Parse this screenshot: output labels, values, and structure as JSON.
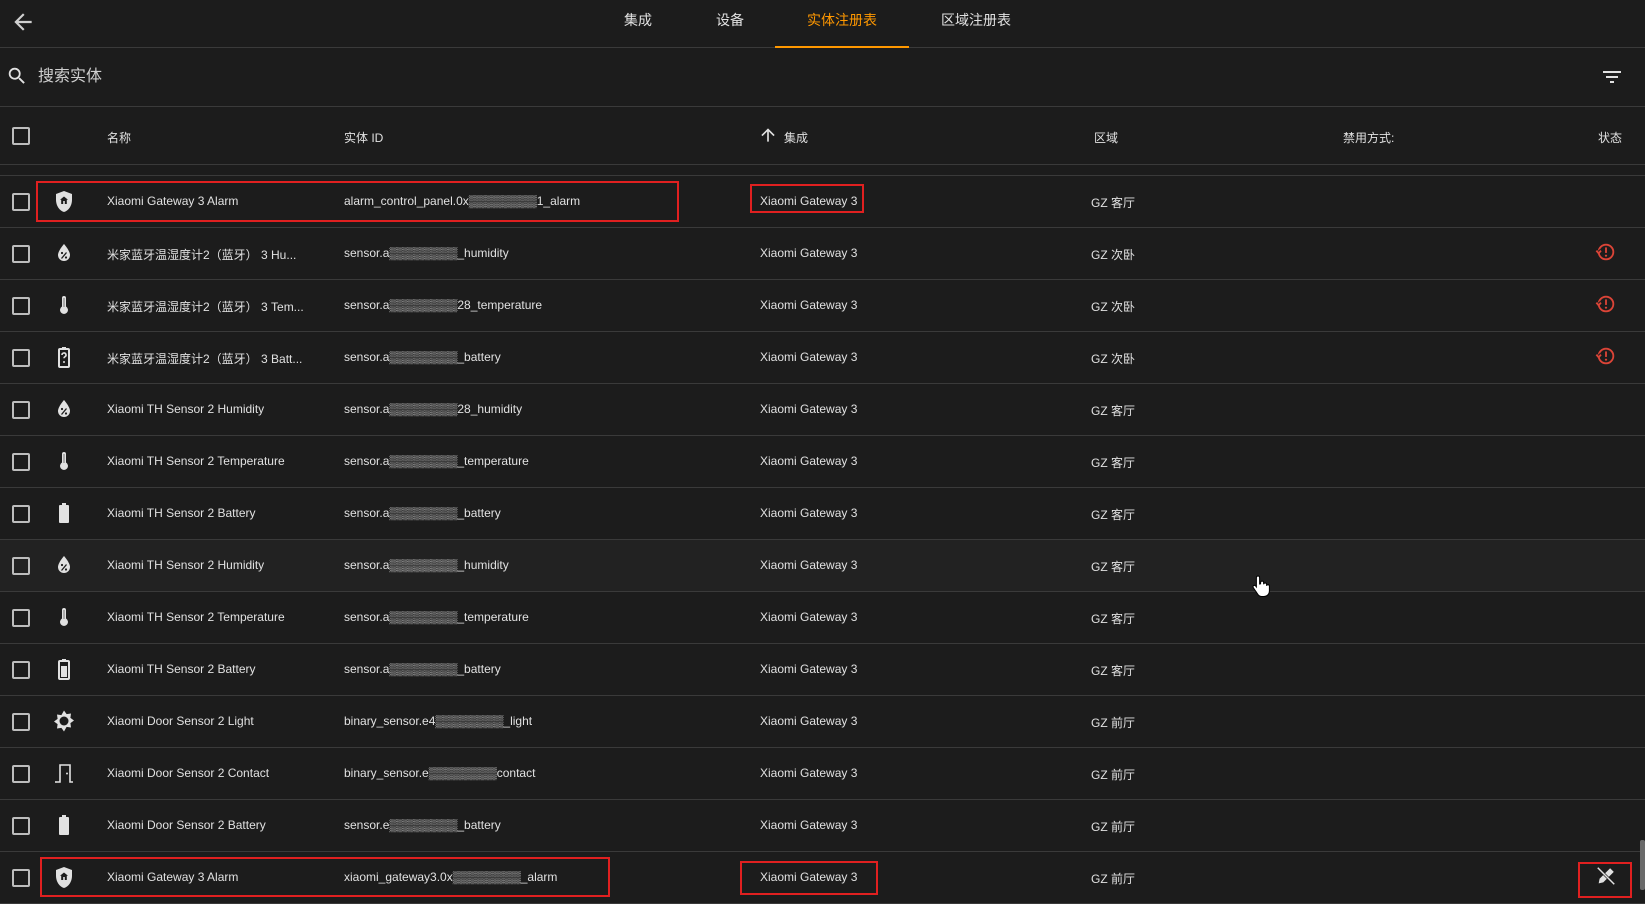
{
  "nav": {
    "tabs": [
      {
        "label": "集成"
      },
      {
        "label": "设备"
      },
      {
        "label": "实体注册表"
      },
      {
        "label": "区域注册表"
      }
    ],
    "active_tab": "实体注册表"
  },
  "search": {
    "placeholder": "搜索实体"
  },
  "table": {
    "columns": {
      "name": "名称",
      "entity_id": "实体 ID",
      "integration": "集成",
      "area": "区域",
      "disabled_by": "禁用方式:",
      "status": "状态"
    },
    "sort": {
      "column": "集成",
      "direction": "ascending"
    },
    "rows": [
      {
        "icon": "shield-home-icon",
        "name": "Xiaomi Gateway 3 Alarm",
        "entity_id": "alarm_control_panel.0x▒▒▒▒▒▒▒▒1_alarm",
        "integration": "Xiaomi Gateway 3",
        "area": "GZ 客厅",
        "status": ""
      },
      {
        "icon": "water-percent-icon",
        "name": "米家蓝牙温湿度计2（蓝牙） 3 Hu...",
        "entity_id": "sensor.a▒▒▒▒▒▒▒▒_humidity",
        "integration": "Xiaomi Gateway 3",
        "area": "GZ 次卧",
        "status": "restore-icon"
      },
      {
        "icon": "thermometer-icon",
        "name": "米家蓝牙温湿度计2（蓝牙） 3 Tem...",
        "entity_id": "sensor.a▒▒▒▒▒▒▒▒28_temperature",
        "integration": "Xiaomi Gateway 3",
        "area": "GZ 次卧",
        "status": "restore-icon"
      },
      {
        "icon": "battery-unknown-icon",
        "name": "米家蓝牙温湿度计2（蓝牙） 3 Batt...",
        "entity_id": "sensor.a▒▒▒▒▒▒▒▒_battery",
        "integration": "Xiaomi Gateway 3",
        "area": "GZ 次卧",
        "status": "restore-icon"
      },
      {
        "icon": "water-percent-icon",
        "name": "Xiaomi TH Sensor 2 Humidity",
        "entity_id": "sensor.a▒▒▒▒▒▒▒▒28_humidity",
        "integration": "Xiaomi Gateway 3",
        "area": "GZ 客厅",
        "status": ""
      },
      {
        "icon": "thermometer-icon",
        "name": "Xiaomi TH Sensor 2 Temperature",
        "entity_id": "sensor.a▒▒▒▒▒▒▒▒_temperature",
        "integration": "Xiaomi Gateway 3",
        "area": "GZ 客厅",
        "status": ""
      },
      {
        "icon": "battery-icon",
        "name": "Xiaomi TH Sensor 2 Battery",
        "entity_id": "sensor.a▒▒▒▒▒▒▒▒_battery",
        "integration": "Xiaomi Gateway 3",
        "area": "GZ 客厅",
        "status": ""
      },
      {
        "icon": "water-percent-icon",
        "name": "Xiaomi TH Sensor 2 Humidity",
        "entity_id": "sensor.a▒▒▒▒▒▒▒▒_humidity",
        "integration": "Xiaomi Gateway 3",
        "area": "GZ 客厅",
        "status": ""
      },
      {
        "icon": "thermometer-icon",
        "name": "Xiaomi TH Sensor 2 Temperature",
        "entity_id": "sensor.a▒▒▒▒▒▒▒▒_temperature",
        "integration": "Xiaomi Gateway 3",
        "area": "GZ 客厅",
        "status": ""
      },
      {
        "icon": "battery-80-icon",
        "name": "Xiaomi TH Sensor 2 Battery",
        "entity_id": "sensor.a▒▒▒▒▒▒▒▒_battery",
        "integration": "Xiaomi Gateway 3",
        "area": "GZ 客厅",
        "status": ""
      },
      {
        "icon": "brightness-icon",
        "name": "Xiaomi Door Sensor 2 Light",
        "entity_id": "binary_sensor.e4▒▒▒▒▒▒▒▒_light",
        "integration": "Xiaomi Gateway 3",
        "area": "GZ 前厅",
        "status": ""
      },
      {
        "icon": "door-icon",
        "name": "Xiaomi Door Sensor 2 Contact",
        "entity_id": "binary_sensor.e▒▒▒▒▒▒▒▒contact",
        "integration": "Xiaomi Gateway 3",
        "area": "GZ 前厅",
        "status": ""
      },
      {
        "icon": "battery-icon",
        "name": "Xiaomi Door Sensor 2 Battery",
        "entity_id": "sensor.e▒▒▒▒▒▒▒▒_battery",
        "integration": "Xiaomi Gateway 3",
        "area": "GZ 前厅",
        "status": ""
      },
      {
        "icon": "shield-home-icon",
        "name": "Xiaomi Gateway 3 Alarm",
        "entity_id": "xiaomi_gateway3.0x▒▒▒▒▒▒▒▒_alarm",
        "integration": "Xiaomi Gateway 3",
        "area": "GZ 前厅",
        "status": "pencil-off-icon"
      }
    ]
  },
  "colors": {
    "accent": "#ff9800",
    "status_error": "#db4437",
    "highlight_box": "#e02020",
    "background": "#1c1c1c"
  }
}
